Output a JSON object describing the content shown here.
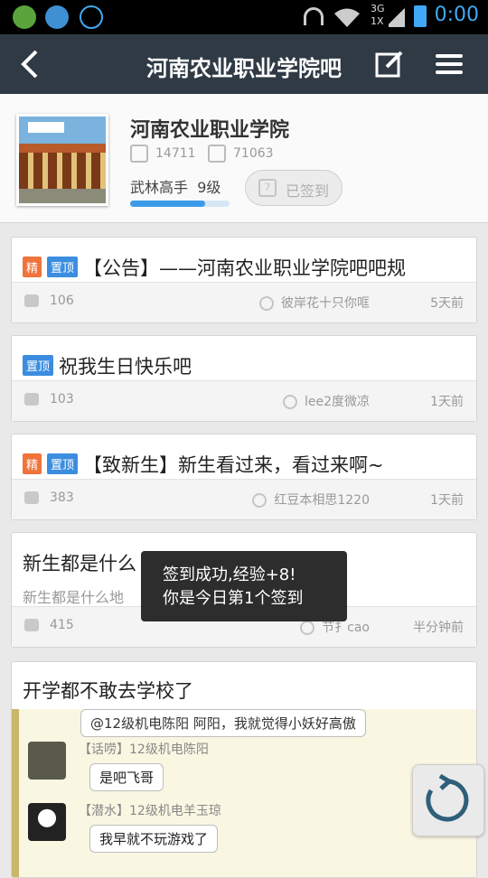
{
  "status_bar": {
    "time": "0:00",
    "net_top": "3G",
    "net_bottom": "1X"
  },
  "header": {
    "title": "河南农业职业学院吧"
  },
  "forum": {
    "name": "河南农业职业学院",
    "members": "14711",
    "posts": "71063",
    "level_title": "武林高手",
    "level": "9级",
    "exp_progress": 0.75,
    "signed_label": "已签到",
    "calendar_day": "7"
  },
  "threads": [
    {
      "tags": [
        "精",
        "置顶"
      ],
      "title": "【公告】——河南农业职业学院吧吧规",
      "comments": "106",
      "author": "彼岸花十只你哐",
      "time": "5天前"
    },
    {
      "tags": [
        "置顶"
      ],
      "title": "祝我生日快乐吧",
      "comments": "103",
      "author": "lee2度微凉",
      "time": "1天前"
    },
    {
      "tags": [
        "精",
        "置顶"
      ],
      "title": "【致新生】新生看过来，看过来啊~",
      "comments": "383",
      "author": "红豆本相思1220",
      "time": "1天前"
    },
    {
      "tags": [],
      "title": "新生都是什么",
      "abstract": "新生都是什么地",
      "comments": "415",
      "author": "节扌cao",
      "time": "半分钟前"
    },
    {
      "tags": [],
      "title": "开学都不敢去学校了"
    }
  ],
  "toast": {
    "line1": "签到成功,经验+8!",
    "line2": "你是今日第1个签到"
  },
  "embedded_chat": [
    {
      "name": "",
      "message": "@12级机电陈阳  阿阳，我就觉得小妖好高傲"
    },
    {
      "name": "【话唠】12级机电陈阳",
      "message": "是吧飞哥"
    },
    {
      "name": "【潜水】12级机电羊玉琼",
      "message": "我早就不玩游戏了"
    }
  ],
  "colors": {
    "header_bg": "#2f3a45",
    "accent_blue": "#3b8de0",
    "jing_orange": "#f0733b",
    "time_blue": "#3fa9f5"
  }
}
